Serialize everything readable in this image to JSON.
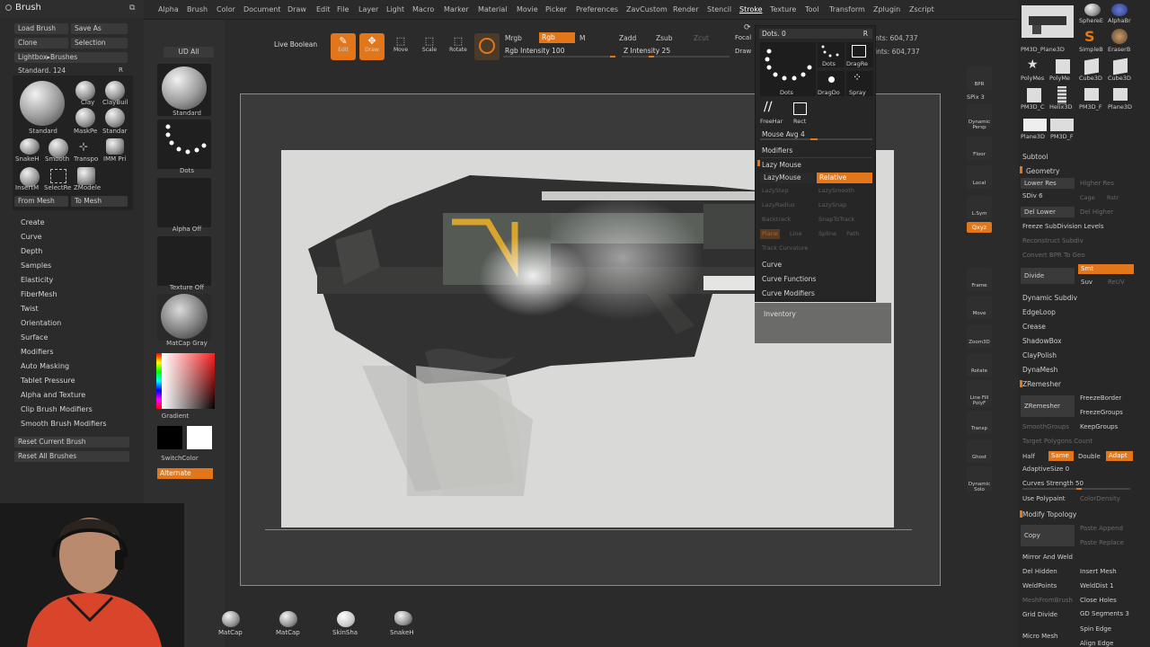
{
  "app": {
    "palette_title": "Brush",
    "accent_color": "#e2761b"
  },
  "menu": [
    "Alpha",
    "Brush",
    "Color",
    "Document",
    "Draw",
    "Edit",
    "File",
    "Layer",
    "Light",
    "Macro",
    "Marker",
    "Material",
    "Movie",
    "Picker",
    "Preferences",
    "ZavCustom",
    "Render",
    "Stencil",
    "Stroke",
    "Texture",
    "Tool",
    "Transform",
    "Zplugin",
    "Zscript"
  ],
  "brush_panel": {
    "load_brush": "Load Brush",
    "save_as": "Save As",
    "clone": "Clone",
    "selection": "Selection",
    "lightbox_brushes": "Lightbox▸Brushes",
    "current": "Standard. 124",
    "r": "R",
    "brushes": [
      {
        "label": "Standard"
      },
      {
        "label": "Clay"
      },
      {
        "label": "ClayBuil"
      },
      {
        "label": "MaskPe"
      },
      {
        "label": "Standar"
      },
      {
        "label": "SnakeH"
      },
      {
        "label": "Smooth"
      },
      {
        "label": "Transpo"
      },
      {
        "label": "IMM Pri"
      },
      {
        "label": "InsertM"
      },
      {
        "label": "SelectRe"
      },
      {
        "label": "ZModele"
      }
    ],
    "from_mesh": "From Mesh",
    "to_mesh": "To Mesh",
    "sections": [
      "Create",
      "Curve",
      "Depth",
      "Samples",
      "Elasticity",
      "FiberMesh",
      "Twist",
      "Orientation",
      "Surface",
      "Modifiers",
      "Auto Masking",
      "Tablet Pressure",
      "Alpha and Texture",
      "Clip Brush Modifiers",
      "Smooth Brush Modifiers"
    ],
    "reset_current": "Reset Current Brush",
    "reset_all": "Reset All Brushes"
  },
  "shelf": {
    "ud_all": "UD All",
    "standard": "Standard",
    "dots": "Dots",
    "alpha_off": "Alpha Off",
    "texture_off": "Texture Off",
    "matcap": "MatCap Gray",
    "gradient": "Gradient",
    "switch_color": "SwitchColor",
    "alternate": "Alternate"
  },
  "topbar": {
    "live_boolean": "Live Boolean",
    "edit": "Edit",
    "draw": "Draw",
    "move": "Move",
    "scale": "Scale",
    "rotate": "Rotate",
    "mrgb": "Mrgb",
    "rgb": "Rgb",
    "m": "M",
    "rgb_intensity": "Rgb Intensity 100",
    "zadd": "Zadd",
    "zsub": "Zsub",
    "zcut": "Zcut",
    "z_intensity": "Z Intensity 25",
    "focal": "Focal",
    "draw_label": "Draw",
    "active_points": "nts: 604,737",
    "total_points": "ints: 604,737"
  },
  "stroke_popup": {
    "header": "Dots. 0",
    "r": "R",
    "strokes": [
      {
        "label": "Dots"
      },
      {
        "label": "Dots"
      },
      {
        "label": "DragRe"
      },
      {
        "label": "DragDo"
      },
      {
        "label": "Spray"
      },
      {
        "label": "FreeHar"
      },
      {
        "label": "Rect"
      }
    ],
    "mouse_avg": "Mouse Avg 4",
    "mouse_avg_value": 4,
    "modifiers": "Modifiers",
    "lazy_mouse": "Lazy Mouse",
    "lazymouse_btn": "LazyMouse",
    "relative": "Relative",
    "lazy_step": "LazyStep",
    "lazy_smooth": "LazySmooth",
    "lazy_radius": "LazyRadius",
    "lazy_snap": "LazySnap",
    "backtrack": "Backtrack",
    "snap_to_track": "SnapToTrack",
    "plane": "Plane",
    "line": "Line",
    "spline": "Spline",
    "path": "Path",
    "track_curvature": "Track Curvature",
    "curve": "Curve",
    "curve_functions": "Curve Functions",
    "curve_modifiers": "Curve Modifiers",
    "inventory": "Inventory"
  },
  "right_toolbar": [
    "BPR",
    "SPix 3",
    "Dynamic Persp",
    "Floor",
    "Local",
    "L.Sym",
    "Qxyz",
    "Frame",
    "Move",
    "Zoom3D",
    "Rotate",
    "Line Fill PolyF",
    "Transp",
    "Ghost",
    "Dynamic Solo"
  ],
  "tool_panel": {
    "thumbs": [
      {
        "label": "SphereE"
      },
      {
        "label": "AlphaBr"
      },
      {
        "label": "PM3D_Plane3D"
      },
      {
        "label": "SimpleB"
      },
      {
        "label": "EraserB"
      },
      {
        "label": "PolyMes"
      },
      {
        "label": "PolyMe"
      },
      {
        "label": "Cube3D"
      },
      {
        "label": "Cube3D"
      },
      {
        "label": "PM3D_C"
      },
      {
        "label": "Helix3D"
      },
      {
        "label": "PM3D_F"
      },
      {
        "label": "Plane3D"
      },
      {
        "label": "Plane3D"
      },
      {
        "label": "PM3D_F"
      }
    ],
    "subtool": "Subtool",
    "geometry": "Geometry",
    "lower_res": "Lower Res",
    "higher_res": "Higher Res",
    "sdiv": "SDiv 6",
    "cage": "Cage",
    "rstr": "Rstr",
    "del_lower": "Del Lower",
    "del_higher": "Del Higher",
    "freeze_subdiv": "Freeze SubDivision Levels",
    "reconstruct": "Reconstruct Subdiv",
    "convert_bpr": "Convert BPR To Geo",
    "divide": "Divide",
    "smt": "Smt",
    "suv": "Suv",
    "reuv": "ReUV",
    "dynamic_subdiv": "Dynamic Subdiv",
    "edgeloop": "EdgeLoop",
    "crease": "Crease",
    "shadowbox": "ShadowBox",
    "claypolish": "ClayPolish",
    "dynamesh": "DynaMesh",
    "zremesher_section": "ZRemesher",
    "zremesher_btn": "ZRemesher",
    "freeze_border": "FreezeBorder",
    "freeze_groups": "FreezeGroups",
    "smooth_groups": "SmoothGroups",
    "keep_groups": "KeepGroups",
    "target_poly": "Target Polygons Count",
    "half": "Half",
    "same": "Same",
    "double": "Double",
    "adapt": "Adapt",
    "adaptive_size": "AdaptiveSize 0",
    "curves_strength": "Curves Strength 50",
    "curves_strength_value": 50,
    "use_polypaint": "Use Polypaint",
    "color_density": "ColorDensity",
    "modify_topology": "Modify Topology",
    "copy": "Copy",
    "paste_append": "Paste Append",
    "paste_replace": "Paste Replace",
    "mirror_weld": "Mirror And Weld",
    "del_hidden": "Del Hidden",
    "insert_mesh": "Insert Mesh",
    "weld_points": "WeldPoints",
    "weld_dist": "WeldDist 1",
    "mesh_from_brush": "MeshFromBrush",
    "close_holes": "Close Holes",
    "grid_divide": "Grid Divide",
    "gd_segments": "GD Segments 3",
    "micro_mesh": "Micro Mesh",
    "spin_edge": "Spin Edge",
    "align_edge": "Align Edge"
  },
  "bottom_materials": [
    {
      "label": "MatCap"
    },
    {
      "label": "MatCap"
    },
    {
      "label": "SkinSha"
    },
    {
      "label": "SnakeH"
    }
  ]
}
